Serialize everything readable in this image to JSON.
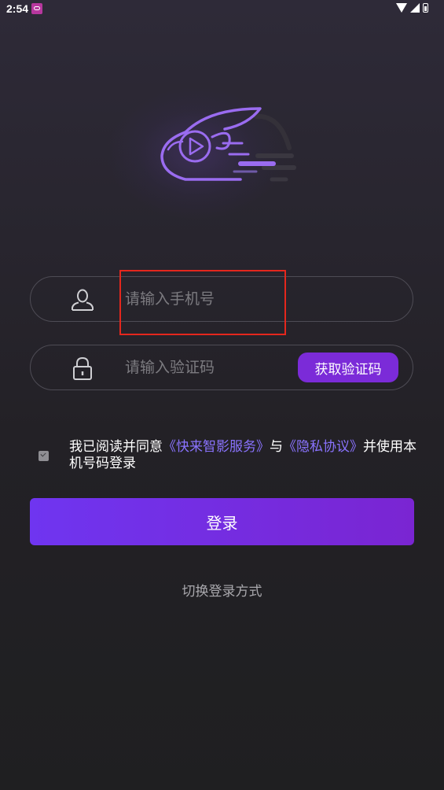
{
  "status_bar": {
    "time": "2:54",
    "icons": [
      "notification-app-icon",
      "wifi-icon",
      "cellular-signal-icon",
      "battery-icon"
    ]
  },
  "logo": {
    "icon": "rabbit-play-logo-icon",
    "accent_color": "#9a6cf0"
  },
  "phone_field": {
    "icon": "user-icon",
    "placeholder": "请输入手机号",
    "value": ""
  },
  "code_field": {
    "icon": "lock-icon",
    "placeholder": "请输入验证码",
    "value": "",
    "get_code_label": "获取验证码"
  },
  "agreement": {
    "checked": true,
    "prefix": "我已阅读并同意",
    "service_link": "《快来智影服务》",
    "and": "与",
    "privacy_link": "《隐私协议》",
    "suffix": "并使用本机号码登录"
  },
  "login_button": {
    "label": "登录"
  },
  "switch_link": {
    "label": "切换登录方式"
  },
  "colors": {
    "primary": "#7b2bd8",
    "link": "#8a73ff",
    "highlight": "#e4271d"
  }
}
